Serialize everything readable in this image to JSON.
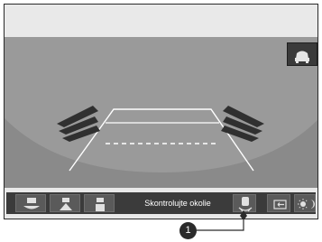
{
  "screen": {
    "status_text": "Skontrolujte okolie",
    "toolbar_icons": [
      "camera-wide-view-icon",
      "camera-normal-view-icon",
      "camera-top-view-icon",
      "parking-sensor-car-icon",
      "exit-icon",
      "brightness-icon"
    ],
    "view_toggle_icon": "rear-car-view-icon"
  },
  "callout": {
    "number": "1"
  },
  "colors": {
    "toolbar": "#3b3b3b",
    "button": "#5a5a5a",
    "guide_lines": "#ffffff",
    "sky": "#e9e9e9",
    "ground": "#9a9a9a"
  }
}
